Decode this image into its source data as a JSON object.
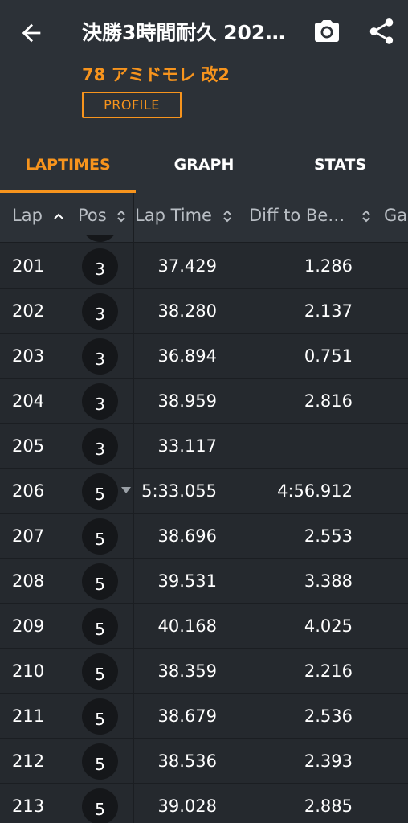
{
  "app_bar": {
    "title": "決勝3時間耐久 202…",
    "subtitle": "78 アミドモレ 改2",
    "profile_button": "PROFILE"
  },
  "tabs": [
    {
      "label": "LAPTIMES",
      "active": true
    },
    {
      "label": "GRAPH",
      "active": false
    },
    {
      "label": "STATS",
      "active": false
    }
  ],
  "table": {
    "columns": [
      "Lap",
      "Pos",
      "Lap Time",
      "Diff to Be…",
      "Ga"
    ],
    "rows": [
      {
        "lap": "201",
        "pos": "3",
        "lap_time": "37.429",
        "diff": "1.286"
      },
      {
        "lap": "202",
        "pos": "3",
        "lap_time": "38.280",
        "diff": "2.137"
      },
      {
        "lap": "203",
        "pos": "3",
        "lap_time": "36.894",
        "diff": "0.751"
      },
      {
        "lap": "204",
        "pos": "3",
        "lap_time": "38.959",
        "diff": "2.816"
      },
      {
        "lap": "205",
        "pos": "3",
        "lap_time": "33.117",
        "diff": ""
      },
      {
        "lap": "206",
        "pos": "5",
        "lap_time": "5:33.055",
        "diff": "4:56.912"
      },
      {
        "lap": "207",
        "pos": "5",
        "lap_time": "38.696",
        "diff": "2.553"
      },
      {
        "lap": "208",
        "pos": "5",
        "lap_time": "39.531",
        "diff": "3.388"
      },
      {
        "lap": "209",
        "pos": "5",
        "lap_time": "40.168",
        "diff": "4.025"
      },
      {
        "lap": "210",
        "pos": "5",
        "lap_time": "38.359",
        "diff": "2.216"
      },
      {
        "lap": "211",
        "pos": "5",
        "lap_time": "38.679",
        "diff": "2.536"
      },
      {
        "lap": "212",
        "pos": "5",
        "lap_time": "38.536",
        "diff": "2.393"
      },
      {
        "lap": "213",
        "pos": "5",
        "lap_time": "39.028",
        "diff": "2.885"
      }
    ]
  },
  "colors": {
    "accent": "#f7941d",
    "background": "#25292e",
    "bar": "#2c3137"
  },
  "icons": [
    "arrow-back-icon",
    "camera-icon",
    "share-icon",
    "sort-ascending-icon",
    "sort-icon",
    "position-drop-icon"
  ]
}
